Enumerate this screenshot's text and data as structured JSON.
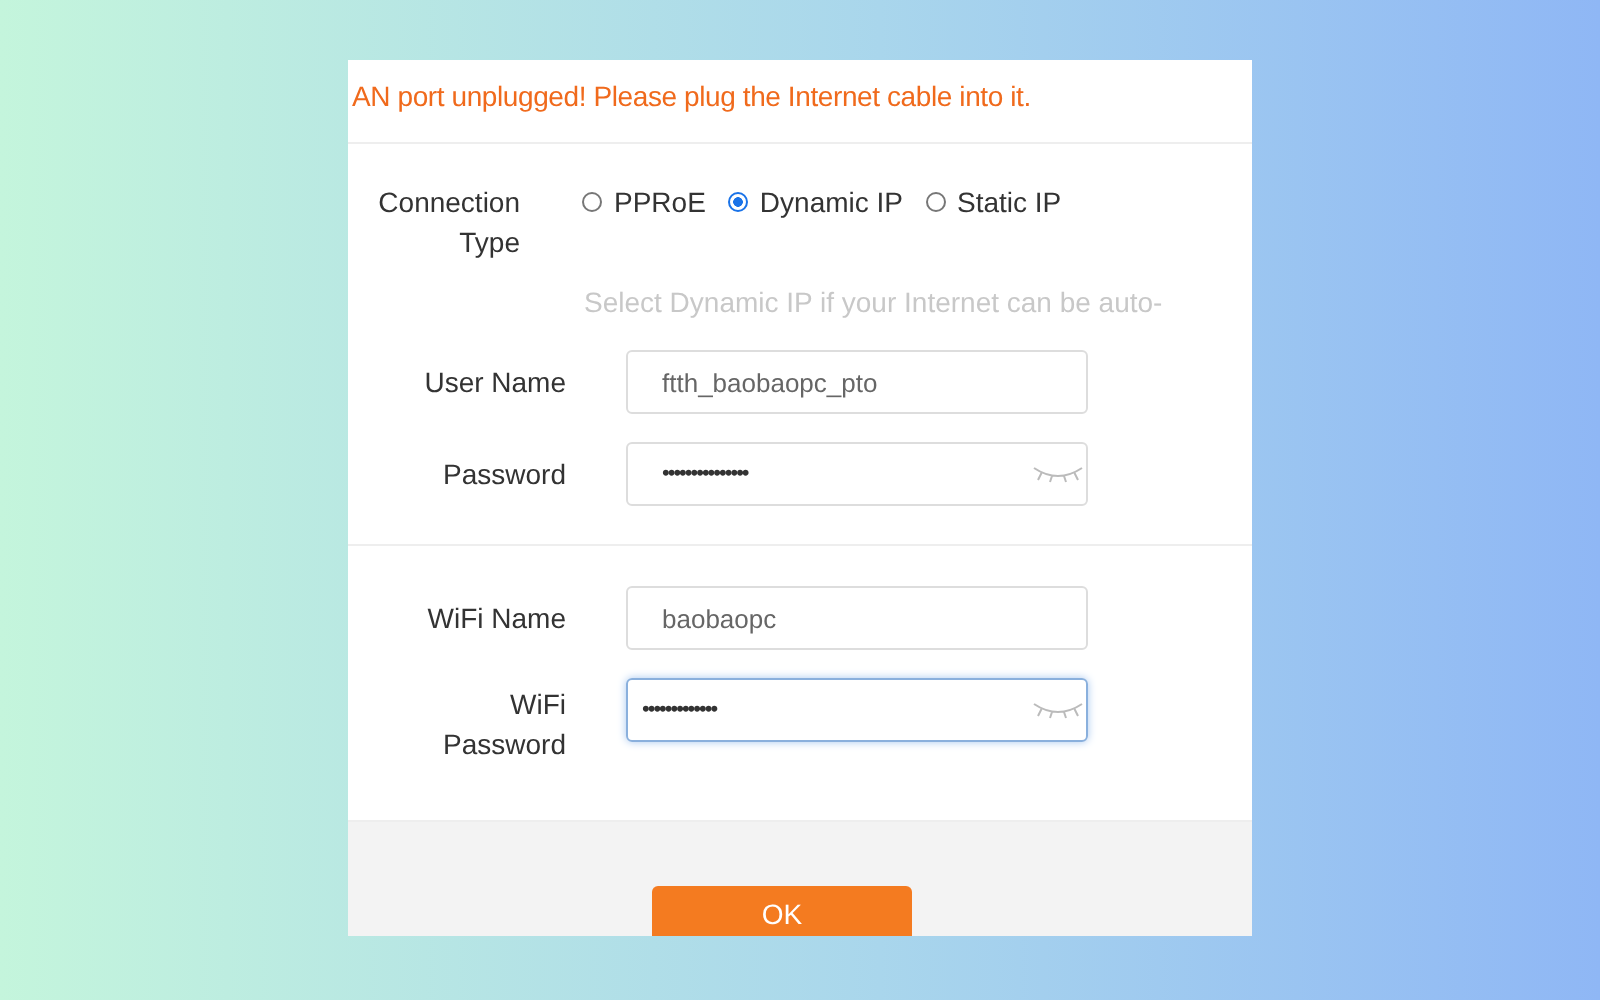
{
  "warning": "AN port unplugged! Please plug the Internet cable into it.",
  "connection": {
    "label": "Connection Type",
    "options": [
      {
        "label": "PPRoE",
        "selected": false
      },
      {
        "label": "Dynamic IP",
        "selected": true
      },
      {
        "label": "Static IP",
        "selected": false
      }
    ],
    "hint": "Select Dynamic IP if your Internet can be auto-"
  },
  "wan_fields": [
    {
      "label": "User Name",
      "value": "ftth_baobaopc_pto",
      "kind": "text",
      "focused": false
    },
    {
      "label": "Password",
      "value": "•••••••••••••••",
      "kind": "password",
      "focused": false
    }
  ],
  "wifi_fields": [
    {
      "label": "WiFi Name",
      "value": "baobaopc",
      "kind": "text",
      "focused": false
    },
    {
      "label": "WiFi Password",
      "value": "•••••••••••••",
      "kind": "password",
      "focused": true
    }
  ],
  "ok_button": "OK"
}
